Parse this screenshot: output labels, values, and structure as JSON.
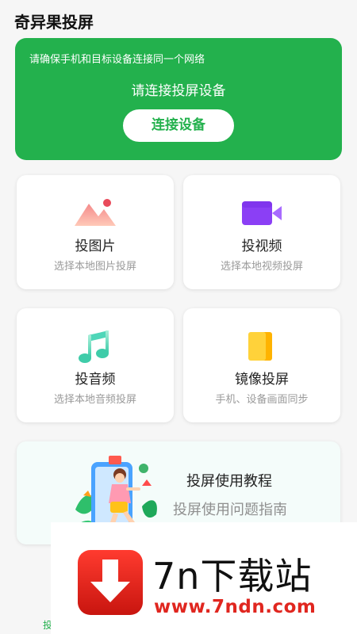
{
  "app": {
    "title": "奇异果投屏"
  },
  "banner": {
    "hint": "请确保手机和目标设备连接同一个网络",
    "title": "请连接投屏设备",
    "button": "连接设备"
  },
  "cards": [
    {
      "id": "images",
      "icon": "image-icon",
      "title": "投图片",
      "subtitle": "选择本地图片投屏"
    },
    {
      "id": "video",
      "icon": "video-camera-icon",
      "title": "投视频",
      "subtitle": "选择本地视频投屏"
    },
    {
      "id": "audio",
      "icon": "music-note-icon",
      "title": "投音频",
      "subtitle": "选择本地音频投屏"
    },
    {
      "id": "mirror",
      "icon": "mirror-screen-icon",
      "title": "镜像投屏",
      "subtitle": "手机、设备画面同步"
    }
  ],
  "tutorial": {
    "title": "投屏使用教程",
    "subtitle": "投屏使用问题指南",
    "illustration": "tutorial-illustration"
  },
  "watermark": {
    "title": "7n下载站",
    "url": "www.7ndn.com",
    "logo": "download-arrow-logo"
  },
  "bottom_fragment": "投",
  "colors": {
    "brand_green": "#23b14d",
    "video_purple": "#8b3ff5",
    "image_red": "#f06a6a",
    "music_teal": "#4fd6b8",
    "mirror_yellow": "#ffd23a",
    "watermark_red": "#e0261f"
  }
}
